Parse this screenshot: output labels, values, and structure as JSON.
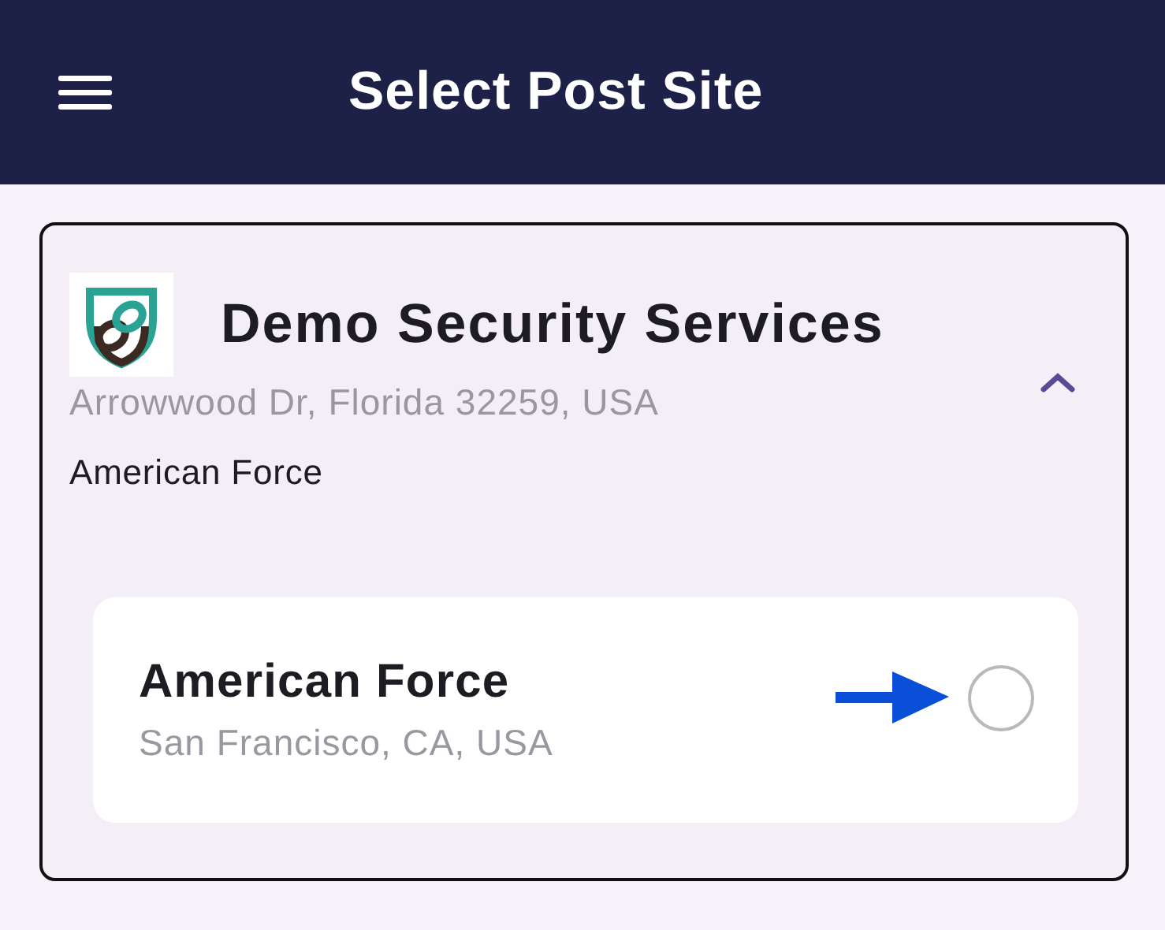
{
  "header": {
    "title": "Select Post Site"
  },
  "company": {
    "name": "Demo Security Services",
    "address": "Arrowwood Dr, Florida 32259, USA",
    "expanded": true,
    "group": "American Force"
  },
  "sites": [
    {
      "name": "American Force",
      "address": "San Francisco, CA, USA",
      "selected": false
    }
  ]
}
